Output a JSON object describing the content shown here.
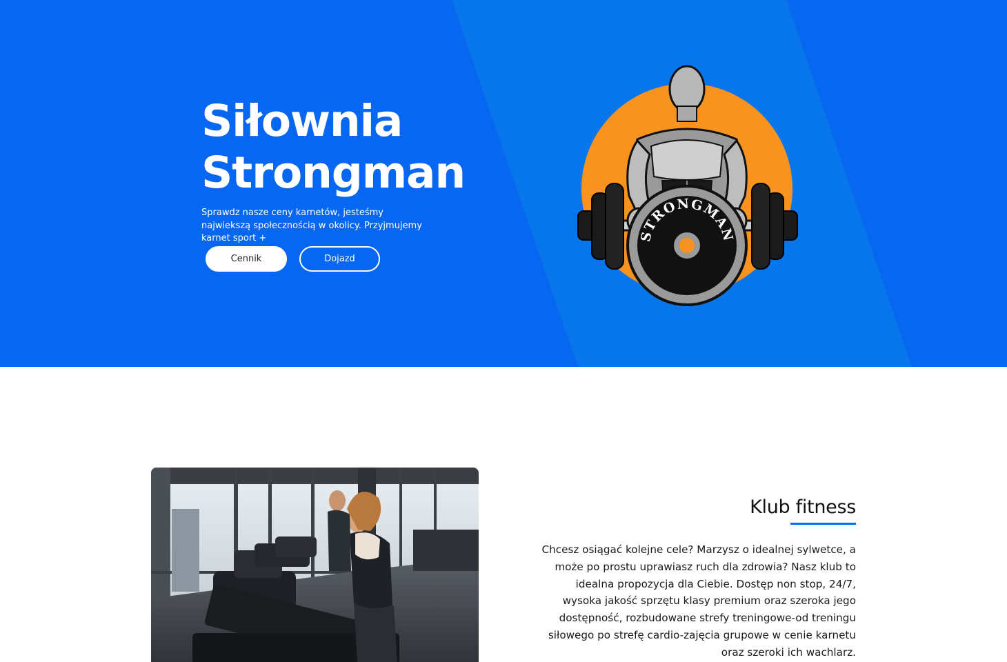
{
  "hero": {
    "title_line1": "Siłownia",
    "title_line2": "Strongman",
    "subtitle": "Sprawdz nasze ceny karnetów, jesteśmy najwiekszą społecznością w okolicy. Przyjmujemy karnet sport +",
    "buttons": {
      "pricing": "Cennik",
      "directions": "Dojazd"
    },
    "logo_text": "STRONGMAN"
  },
  "about": {
    "title": "Klub fitness",
    "text": "Chcesz osiągać kolejne cele? Marzysz o idealnej sylwetce, a może po prostu uprawiasz ruch dla zdrowia? Nasz klub to idealna propozycja dla Ciebie. Dostęp non stop, 24/7, wysoka jakość sprzętu klasy premium oraz szeroka jego dostępność, rozbudowane strefy treningowe-od treningu siłowego po strefę cardio-zajęcia grupowe w cenie karnetu oraz szeroki ich wachlarz."
  },
  "colors": {
    "hero_bg": "#0867f0",
    "hero_stripe": "#0a84e8",
    "logo_circle": "#f7931e",
    "accent": "#0a6af0"
  },
  "icons": {
    "logo": "strongman-bodybuilder-logo",
    "photo": "treadmill-gym-photo"
  }
}
